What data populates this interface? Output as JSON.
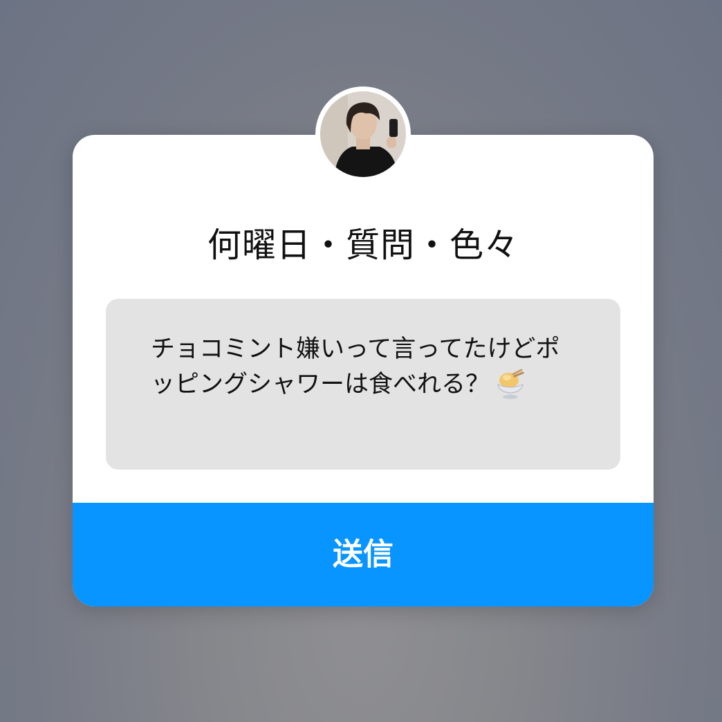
{
  "question_card": {
    "title": "何曜日・質問・色々",
    "question_text": "チョコミント嫌いって言ってたけどポッピングシャワーは食べれる？",
    "question_icon": "ice-cream-sundae-icon",
    "send_label": "送信"
  },
  "colors": {
    "send_button": "#0895ff",
    "question_box": "#e3e3e3",
    "card": "#ffffff"
  }
}
